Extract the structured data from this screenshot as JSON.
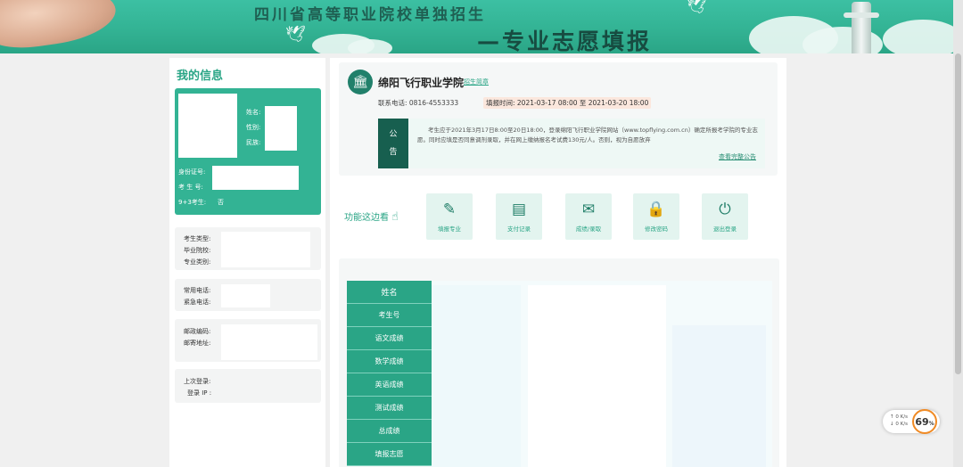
{
  "banner": {
    "title_top": "四川省高等职业院校单独招生",
    "title_bottom": "—专业志愿填报"
  },
  "profile": {
    "title": "我的信息",
    "name_label": "姓名:",
    "gender_label": "性别:",
    "ethnicity_label": "民族:",
    "id_label": "身份证号:",
    "exam_no_label": "考 生 号:",
    "nine_three_label": "9+3考生:",
    "nine_three_value": "否"
  },
  "profile_sections": {
    "candidate_type_label": "考生类型:",
    "graduate_school_label": "毕业院校:",
    "major_category_label": "专业类别:",
    "phone_label": "常用电话:",
    "emergency_phone_label": "紧急电话:",
    "postcode_label": "邮政编码:",
    "address_label": "邮寄地址:",
    "last_login_label": "上次登录:",
    "login_ip_label": "登录 IP :"
  },
  "school": {
    "name": "绵阳飞行职业学院",
    "brochure_link": "招生简章",
    "contact": "联系电话: 0816-4553333",
    "fill_time": "填报时间: 2021-03-17 08:00 至 2021-03-20 18:00",
    "notice_tag_1": "公",
    "notice_tag_2": "告",
    "notice_text": "考生应于2021年3月17日8:00至20日18:00，登录绵阳飞行职业学院网站（www.topflying.com.cn）确定所报考学院的专业志愿。同时应填是否同意调剂录取，并在网上缴纳报名考试费130元/人。否则，视为自愿放弃",
    "notice_more": "查看完整公告"
  },
  "functions": {
    "label": "功能这边看",
    "items": [
      {
        "label": "填报专业",
        "icon": "pencil-icon"
      },
      {
        "label": "支付记录",
        "icon": "receipt-icon"
      },
      {
        "label": "成绩/录取",
        "icon": "envelope-icon"
      },
      {
        "label": "修改密码",
        "icon": "lock-icon"
      },
      {
        "label": "退出登录",
        "icon": "power-icon"
      }
    ]
  },
  "scores": {
    "rows": [
      "姓名",
      "考生号",
      "语文成绩",
      "数学成绩",
      "英语成绩",
      "测试成绩",
      "总成绩",
      "填报志愿"
    ]
  },
  "widget": {
    "up": "0 K/s",
    "down": "0 K/s",
    "percent": "69",
    "percent_unit": "%"
  },
  "colors": {
    "brand": "#33b394",
    "brand_dark": "#175f4f",
    "accent_orange": "#f08a24"
  }
}
